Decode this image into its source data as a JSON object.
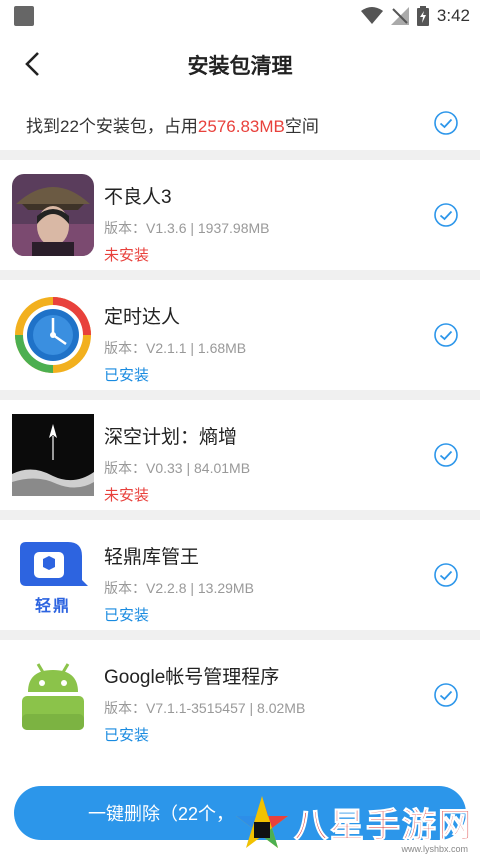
{
  "status_bar": {
    "time": "3:42"
  },
  "header": {
    "title": "安装包清理"
  },
  "summary": {
    "prefix": "找到22个安装包，占用",
    "size": "2576.83MB",
    "suffix": "空间"
  },
  "colors": {
    "accent": "#2c96ea",
    "danger": "#e8413c",
    "installed": "#1a8be0"
  },
  "items": [
    {
      "name": "不良人3",
      "meta": "版本：V1.3.6 | 1937.98MB",
      "status": "未安装",
      "icon": "game-character-icon"
    },
    {
      "name": "定时达人",
      "meta": "版本：V2.1.1 | 1.68MB",
      "status": "已安装",
      "icon": "clock-icon"
    },
    {
      "name": "深空计划：熵增",
      "meta": "版本：V0.33 | 84.01MB",
      "status": "未安装",
      "icon": "rocket-icon"
    },
    {
      "name": "轻鼎库管王",
      "meta": "版本：V2.2.8 | 13.29MB",
      "status": "已安装",
      "icon": "box-icon",
      "icon_label": "轻鼎"
    },
    {
      "name": "Google帐号管理程序",
      "meta": "版本：V7.1.1-3515457 | 8.02MB",
      "status": "已安装",
      "icon": "android-icon"
    }
  ],
  "bottom": {
    "delete_label": "一键删除（22个，"
  },
  "watermark": {
    "text": "八星手游网",
    "url": "www.lyshbx.com"
  }
}
